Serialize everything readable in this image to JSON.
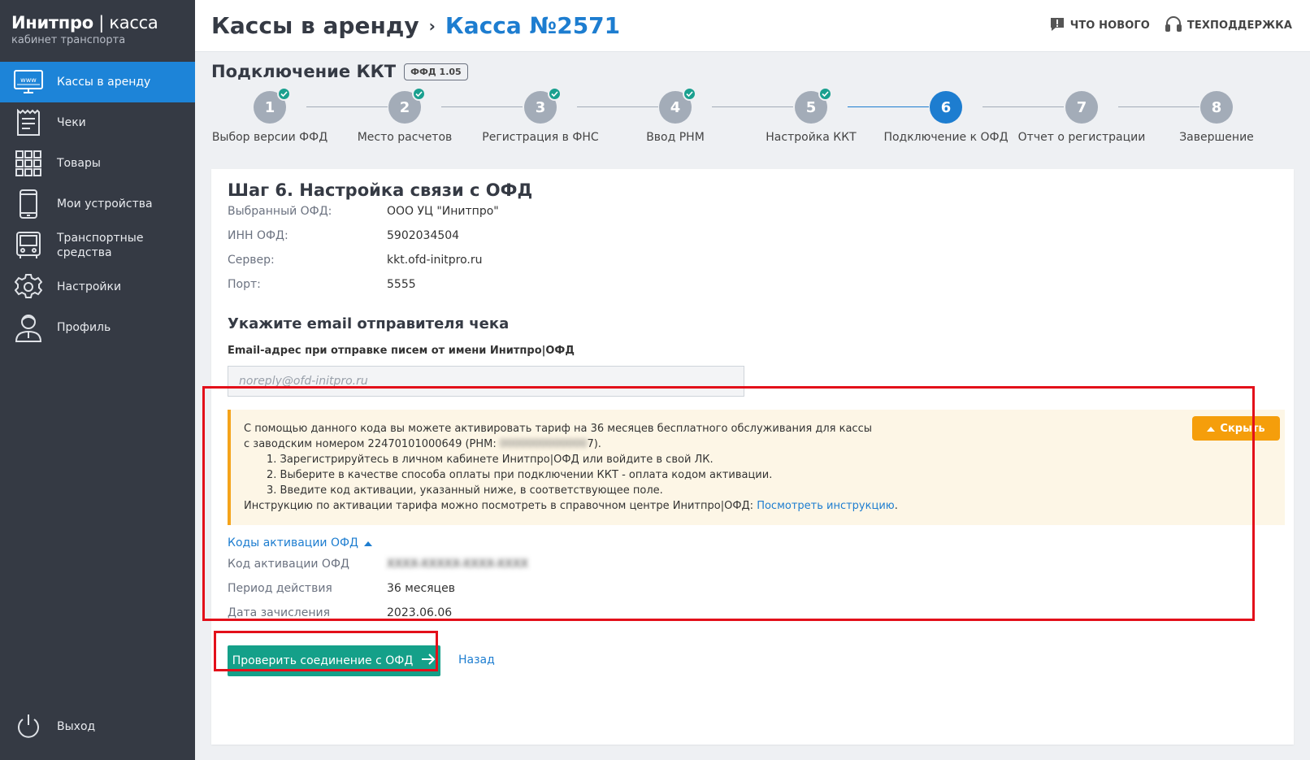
{
  "brand": {
    "name": "Инитпро",
    "sep": " | ",
    "product": "касса",
    "subtitle": "кабинет транспорта"
  },
  "sidebar": {
    "items": [
      {
        "label": "Кассы в аренду",
        "icon": "www-monitor-icon",
        "active": true
      },
      {
        "label": "Чеки",
        "icon": "receipt-icon"
      },
      {
        "label": "Товары",
        "icon": "grid-icon"
      },
      {
        "label": "Мои устройства",
        "icon": "phone-icon"
      },
      {
        "label": "Транспортные средства",
        "icon": "bus-icon"
      },
      {
        "label": "Настройки",
        "icon": "gear-icon"
      },
      {
        "label": "Профиль",
        "icon": "user-icon"
      }
    ],
    "logout": "Выход"
  },
  "header": {
    "crumb_parent": "Кассы в аренду",
    "crumb_current": "Касса №2571",
    "whats_new": "ЧТО НОВОГО",
    "support": "ТЕХПОДДЕРЖКА"
  },
  "section": {
    "title": "Подключение ККТ",
    "badge": "ФФД 1.05"
  },
  "steps": [
    {
      "num": "1",
      "label": "Выбор версии ФФД",
      "done": true
    },
    {
      "num": "2",
      "label": "Место расчетов",
      "done": true
    },
    {
      "num": "3",
      "label": "Регистрация в ФНС",
      "done": true
    },
    {
      "num": "4",
      "label": "Ввод РНМ",
      "done": true
    },
    {
      "num": "5",
      "label": "Настройка ККТ",
      "done": true
    },
    {
      "num": "6",
      "label": "Подключение к ОФД",
      "current": true
    },
    {
      "num": "7",
      "label": "Отчет о регистрации"
    },
    {
      "num": "8",
      "label": "Завершение"
    }
  ],
  "card": {
    "title": "Шаг 6. Настройка связи с ОФД",
    "ofd_fields": [
      {
        "key": "Выбранный ОФД:",
        "value": "ООО УЦ \"Инитпро\""
      },
      {
        "key": "ИНН ОФД:",
        "value": "5902034504"
      },
      {
        "key": "Сервер:",
        "value": "kkt.ofd-initpro.ru"
      },
      {
        "key": "Порт:",
        "value": "5555"
      }
    ],
    "email_heading": "Укажите email отправителя чека",
    "email_label": "Email-адрес при отправке писем от имени Инитпро|ОФД",
    "email_placeholder": "noreply@ofd-initpro.ru",
    "notice": {
      "line1": "С помощью данного кода вы можете активировать тариф на 36 месяцев бесплатного обслуживания для кассы",
      "line2_prefix": "с заводским номером 22470101000649 (РНМ:",
      "line2_blur": "0000000000000",
      "line2_suffix": "7).",
      "step1": "1. Зарегистрируйтесь в личном кабинете Инитпро|ОФД или войдите в свой ЛК.",
      "step2": "2. Выберите в качестве способа оплаты при подключении ККТ - оплата кодом активации.",
      "step3": "3. Введите код активации, указанный ниже, в соответствующее поле.",
      "instr_prefix": "Инструкцию по активации тарифа можно посмотреть в справочном центре Инитпро|ОФД: ",
      "instr_link": "Посмотреть инструкцию",
      "instr_suffix": ".",
      "hide_button": "Скрыть"
    },
    "codes_toggle": "Коды активации ОФД",
    "codes": [
      {
        "key": "Код активации ОФД",
        "value": "XXXX-XXXXX-XXXX-XXXX",
        "blurred": true
      },
      {
        "key": "Период действия",
        "value": "36 месяцев"
      },
      {
        "key": "Дата зачисления",
        "value": "2023.06.06"
      }
    ],
    "check_button": "Проверить соединение с ОФД",
    "back_link": "Назад"
  },
  "colors": {
    "sidebar": "#353a44",
    "accent": "#1d7dd0",
    "teal": "#14a089",
    "orange": "#f59e0b",
    "highlight": "#e3101a"
  }
}
